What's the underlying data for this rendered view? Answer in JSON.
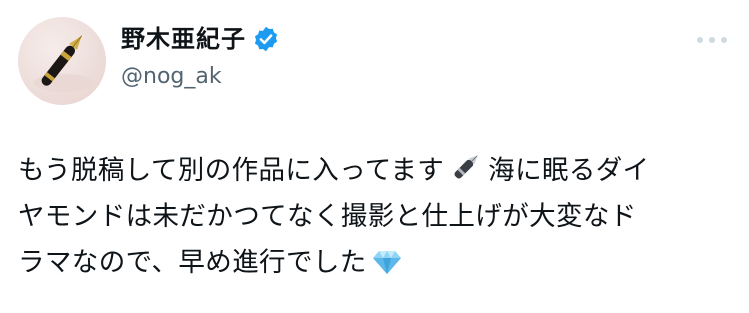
{
  "user": {
    "display_name": "野木亜紀子",
    "handle": "@nog_ak",
    "verified": true,
    "avatar_description_icon": "fountain-pen-avatar"
  },
  "menu": {
    "icon": "more-horizontal-icon"
  },
  "tweet": {
    "line1_a": "もう脱稿して別の作品に入ってます",
    "line1_b": "海に眠るダイ",
    "line2": "ヤモンドは未だかつてなく撮影と仕上げが大変なド",
    "line3": "ラマなので、早め進行でした",
    "emoji_1": "fountain-pen-icon",
    "emoji_2": "gem-icon"
  },
  "colors": {
    "text": "#0f1419",
    "secondary": "#536471",
    "verified_blue": "#1d9bf0",
    "dots": "#cfd9de"
  }
}
